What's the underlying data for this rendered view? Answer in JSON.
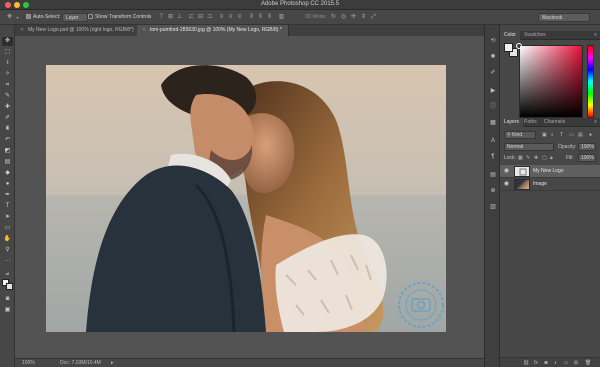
{
  "app": {
    "title": "Adobe Photoshop CC 2015.5"
  },
  "options": {
    "auto_select_label": "Auto-Select:",
    "auto_select_value": "Layer",
    "transform_label": "Show Transform Controls",
    "mode_label": "3D Mode:",
    "workspace": "Macbook"
  },
  "tabs": [
    {
      "label": "My New Logo.psd @ 100% (right logo, RGB/8*)"
    },
    {
      "label": "tom-pumford-285630.jpg @ 100% (My New Logo, RGB/8) *"
    }
  ],
  "status": {
    "zoom": "100%",
    "doc": "Doc: 7.03M/10.4M"
  },
  "color_panel": {
    "tabs": [
      "Color",
      "Swatches"
    ]
  },
  "layers_panel": {
    "tabs": [
      "Layers",
      "Paths",
      "Channels"
    ],
    "kind_filter": "Kind",
    "blend_mode": "Normal",
    "opacity_label": "Opacity:",
    "opacity_value": "100%",
    "lock_label": "Lock:",
    "fill_label": "Fill:",
    "fill_value": "100%",
    "layers": [
      {
        "name": "My New Logo",
        "selected": true
      },
      {
        "name": "Image",
        "selected": false
      }
    ]
  },
  "colors": {
    "accent": "#e8123a",
    "watermark": "#5fa2c8"
  }
}
